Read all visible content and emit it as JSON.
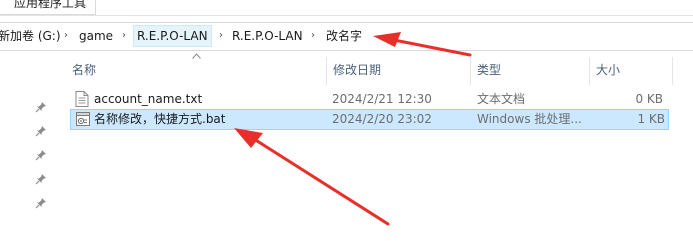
{
  "ribbon": {
    "tab_label": "应用程序工具"
  },
  "breadcrumb": [
    {
      "label": "新加卷 (G:)"
    },
    {
      "label": "game"
    },
    {
      "label": "R.E.P.O-LAN"
    },
    {
      "label": "R.E.P.O-LAN"
    },
    {
      "label": "改名字"
    }
  ],
  "breadcrumb_separator": "›",
  "columns": {
    "name": "名称",
    "modified": "修改日期",
    "type": "类型",
    "size": "大小"
  },
  "files": [
    {
      "name": "account_name.txt",
      "modified": "2024/2/21 12:30",
      "type": "文本文档",
      "size": "0 KB",
      "icon": "text-file-icon",
      "selected": false
    },
    {
      "name": "名称修改，快捷方式.bat",
      "modified": "2024/2/20 23:02",
      "type": "Windows 批处理...",
      "size": "1 KB",
      "icon": "batch-file-icon",
      "selected": true
    }
  ],
  "nav_pins": [
    "pin-icon",
    "pin-icon",
    "pin-icon",
    "pin-icon",
    "pin-icon"
  ],
  "colors": {
    "selection": "#cce8ff",
    "selection_border": "#99d1ff",
    "crumb_highlight": "#e5f3fb",
    "annotation_arrow": "#e8302a",
    "header_text": "#4c607a"
  }
}
